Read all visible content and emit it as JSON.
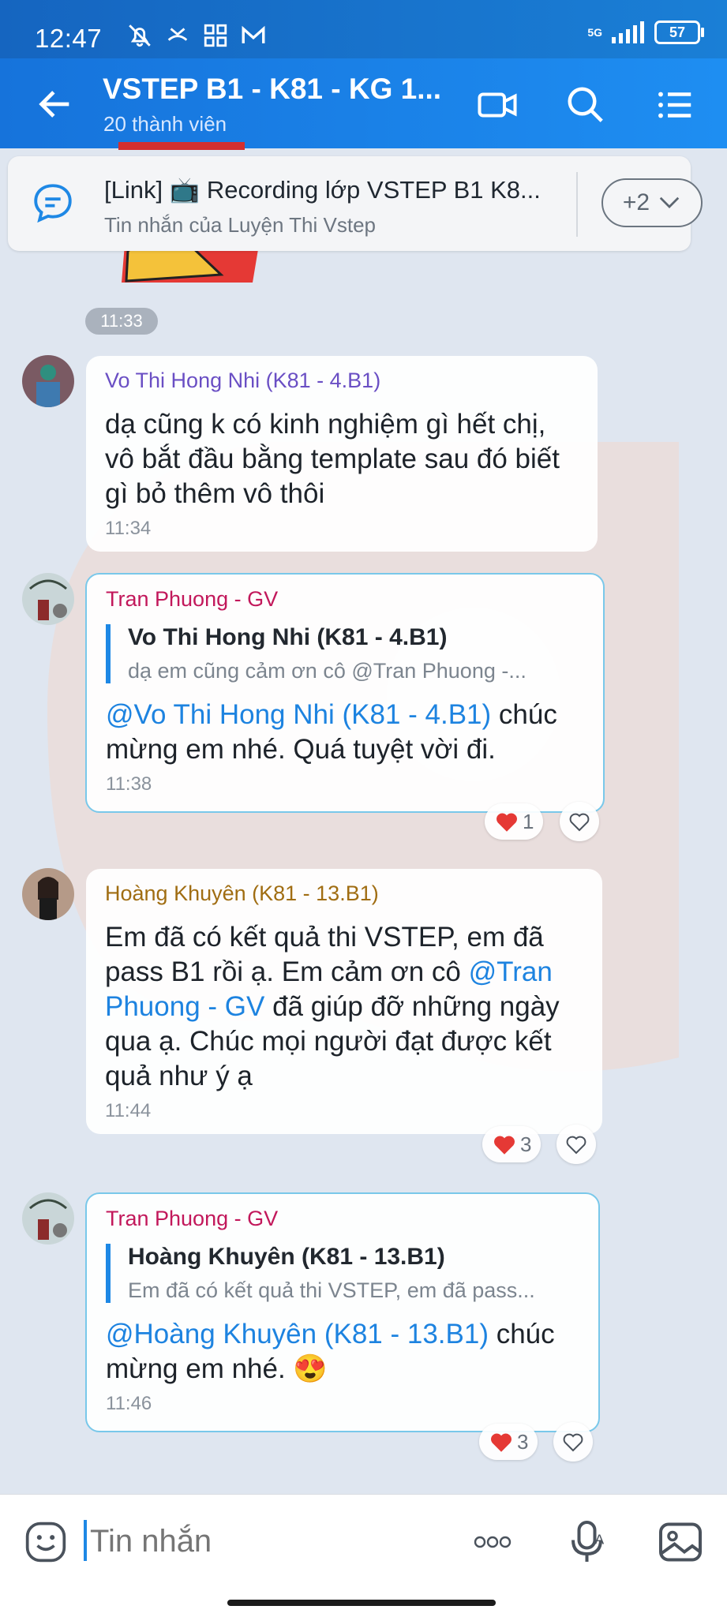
{
  "status_bar": {
    "time": "12:47",
    "network": "5G",
    "battery": "57"
  },
  "header": {
    "title": "VSTEP B1 - K81 - KG 1...",
    "subtitle": "20 thành viên"
  },
  "pinned": {
    "title": "[Link] 📺 Recording lớp VSTEP B1 K8...",
    "subtitle": "Tin nhắn của Luyện Thi Vstep",
    "more": "+2"
  },
  "time_separator": "11:33",
  "messages": [
    {
      "sender": "Vo Thi Hong Nhi (K81 - 4.B1)",
      "sender_color": "#6a4fc4",
      "text": "dạ cũng k có kinh nghiệm gì hết chị, vô bắt đầu bằng template sau đó biết gì bỏ thêm vô thôi",
      "time": "11:34"
    },
    {
      "sender": "Tran Phuong - GV",
      "sender_color": "#c2185b",
      "quote_name": "Vo Thi Hong Nhi (K81 - 4.B1)",
      "quote_text": "dạ em cũng cảm ơn cô @Tran Phuong -...",
      "mention": "@Vo Thi Hong Nhi (K81 - 4.B1)",
      "text": " chúc mừng em nhé. Quá tuyệt vời đi.",
      "time": "11:38",
      "reactions": "1"
    },
    {
      "sender": "Hoàng Khuyên (K81 - 13.B1)",
      "sender_color": "#a06d12",
      "text_before": "Em đã có kết quả thi VSTEP, em đã pass B1 rồi ạ. Em cảm ơn cô ",
      "mention": "@Tran Phuong - GV",
      "text_after": " đã giúp đỡ những ngày qua ạ. Chúc mọi người đạt được kết quả như ý ạ",
      "time": "11:44",
      "reactions": "3"
    },
    {
      "sender": "Tran Phuong - GV",
      "sender_color": "#c2185b",
      "quote_name": "Hoàng Khuyên (K81 - 13.B1)",
      "quote_text": "Em đã có kết quả thi VSTEP, em đã pass...",
      "mention": "@Hoàng Khuyên (K81 - 13.B1)",
      "text": " chúc mừng em nhé. 😍",
      "time": "11:46",
      "reactions": "3"
    }
  ],
  "composer": {
    "placeholder": "Tin nhắn"
  },
  "colors": {
    "header": "#1673db",
    "accent": "#1e88e5",
    "heart": "#e53935"
  },
  "icons": [
    "back-arrow-icon",
    "video-call-icon",
    "search-icon",
    "menu-icon",
    "chat-bubble-icon",
    "chevron-down-icon",
    "heart-icon",
    "like-heart-outline-icon",
    "emoji-icon",
    "more-dots-icon",
    "voice-icon",
    "image-icon"
  ]
}
